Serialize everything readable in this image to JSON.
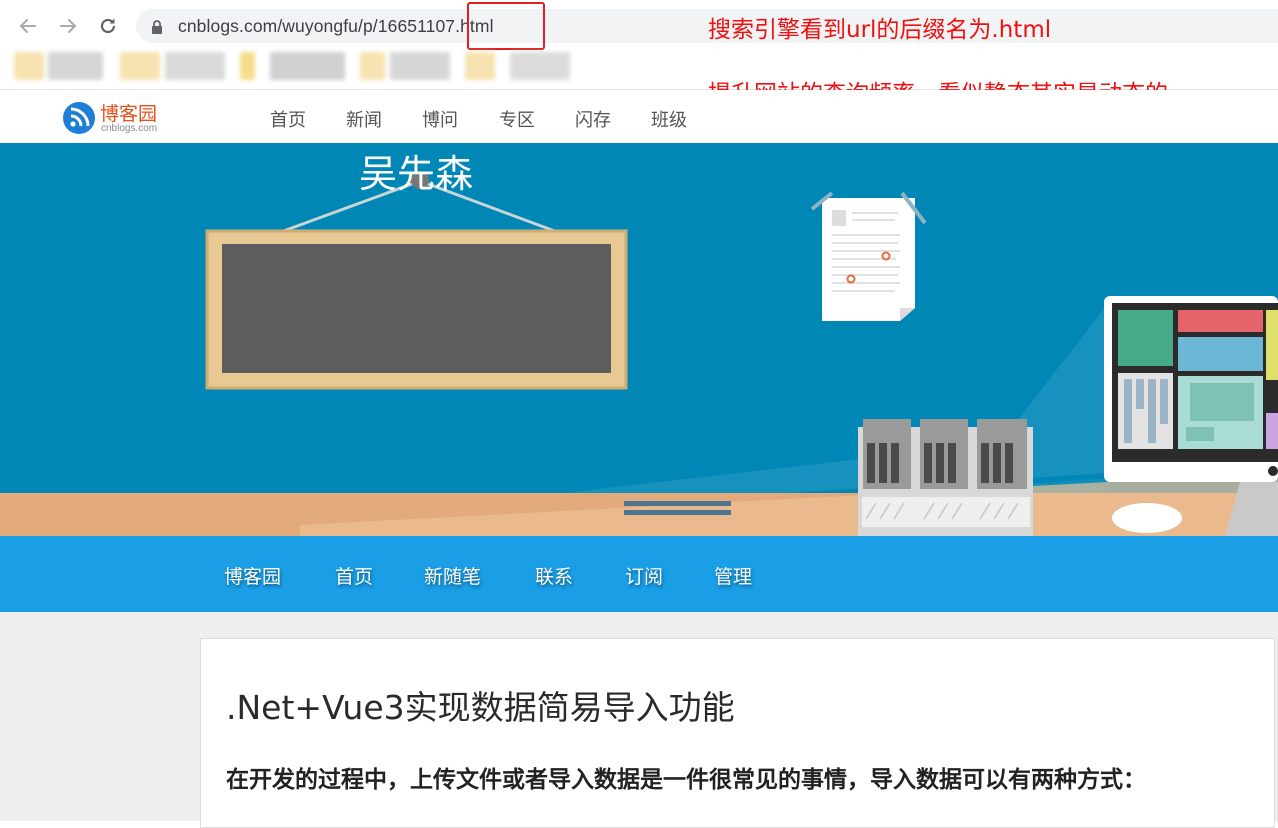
{
  "browser": {
    "url": "cnblogs.com/wuyongfu/p/16651107.html"
  },
  "annotations": {
    "line1": "搜索引擎看到url的后缀名为.html",
    "line2": "提升网站的查询频率，看似静态其实是动态的",
    "color": "#f01010"
  },
  "site": {
    "logo_title": "博客园",
    "logo_sub": "cnblogs.com",
    "nav": [
      "首页",
      "新闻",
      "博问",
      "专区",
      "闪存",
      "班级"
    ]
  },
  "blog": {
    "owner": "吴先森",
    "nav": [
      "博客园",
      "首页",
      "新随笔",
      "联系",
      "订阅",
      "管理"
    ]
  },
  "post": {
    "title": ".Net+Vue3实现数据简易导入功能",
    "lead": "在开发的过程中，上传文件或者导入数据是一件很常见的事情，导入数据可以有两种方式："
  },
  "colors": {
    "banner_blue": "#0187b6",
    "blognav_blue": "#1a9ee6",
    "logo_orange": "#e6521b"
  }
}
